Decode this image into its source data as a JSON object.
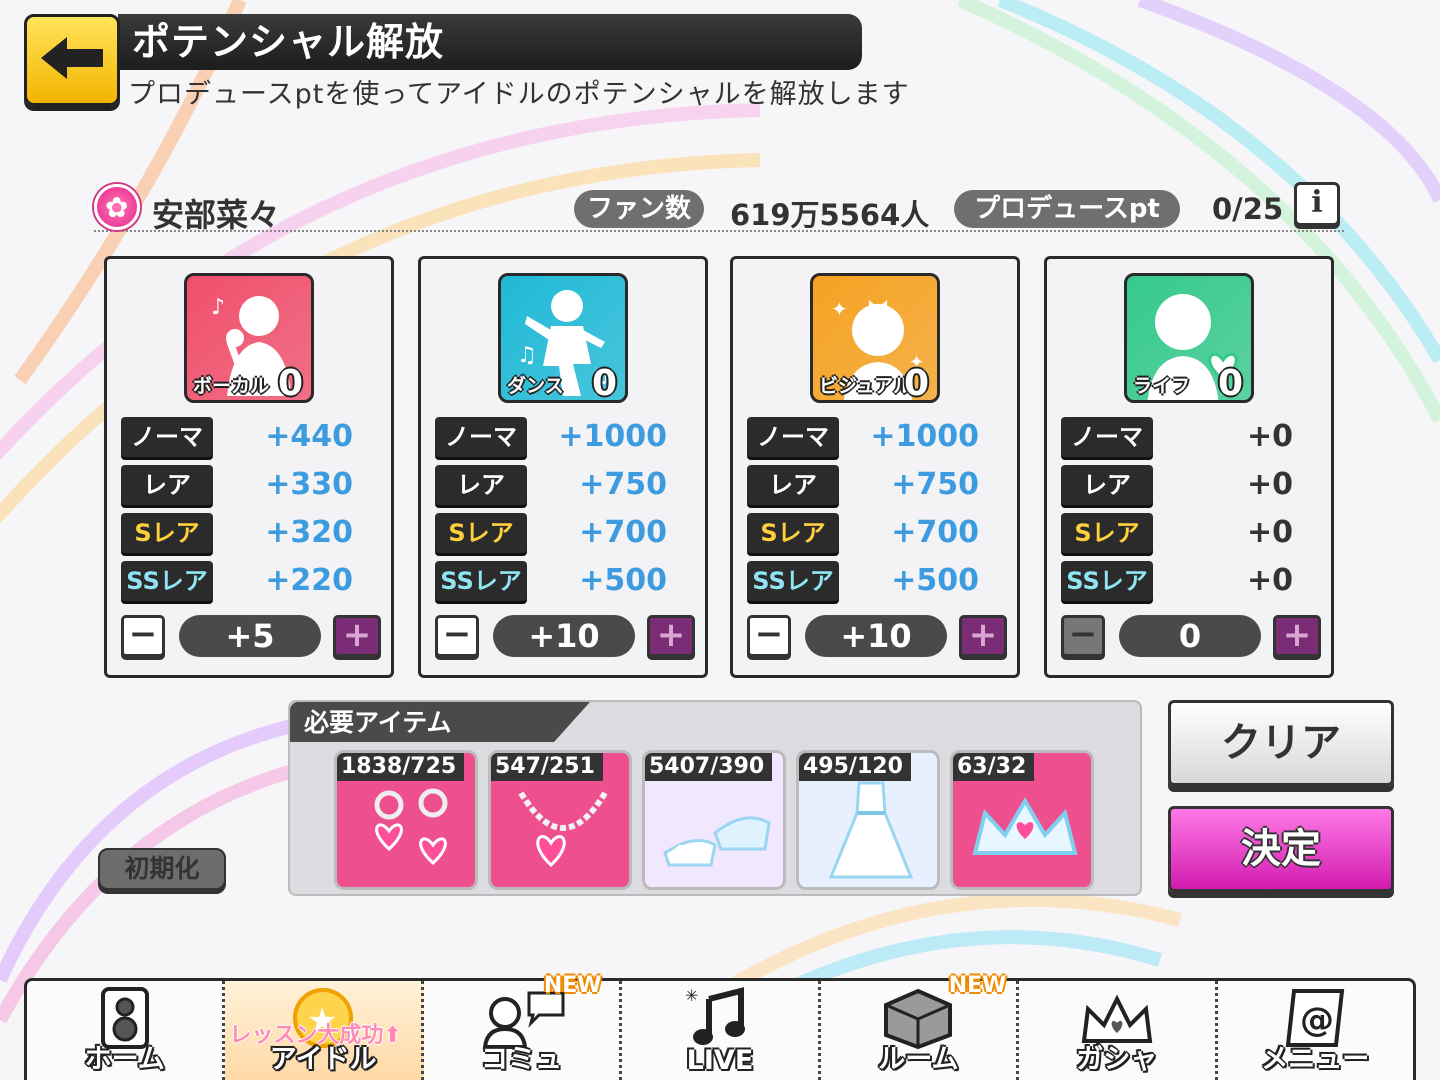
{
  "header": {
    "title": "ポテンシャル解放",
    "subtitle": "プロデュースptを使ってアイドルのポテンシャルを解放します"
  },
  "idol": {
    "name": "安部菜々",
    "fans_label": "ファン数",
    "fans_value": "619万5564人",
    "pt_label": "プロデュースpt",
    "pt_value": "0/25",
    "info_label": "i"
  },
  "panels": [
    {
      "stat": "ボーカル",
      "level": "0",
      "color": "#f04f6b",
      "rows": [
        {
          "rarity": "ノーマル",
          "value": "+440"
        },
        {
          "rarity": "レア",
          "value": "+330"
        },
        {
          "rarity": "Sレア",
          "value": "+320"
        },
        {
          "rarity": "SSレア",
          "value": "+220"
        }
      ],
      "step": "+5"
    },
    {
      "stat": "ダンス",
      "level": "0",
      "color": "#1fb9d6",
      "rows": [
        {
          "rarity": "ノーマル",
          "value": "+1000"
        },
        {
          "rarity": "レア",
          "value": "+750"
        },
        {
          "rarity": "Sレア",
          "value": "+700"
        },
        {
          "rarity": "SSレア",
          "value": "+500"
        }
      ],
      "step": "+10"
    },
    {
      "stat": "ビジュアル",
      "level": "0",
      "color": "#f5a221",
      "rows": [
        {
          "rarity": "ノーマル",
          "value": "+1000"
        },
        {
          "rarity": "レア",
          "value": "+750"
        },
        {
          "rarity": "Sレア",
          "value": "+700"
        },
        {
          "rarity": "SSレア",
          "value": "+500"
        }
      ],
      "step": "+10"
    },
    {
      "stat": "ライフ",
      "level": "0",
      "color": "#35c98c",
      "rows": [
        {
          "rarity": "ノーマル",
          "value": "+0"
        },
        {
          "rarity": "レア",
          "value": "+0"
        },
        {
          "rarity": "Sレア",
          "value": "+0"
        },
        {
          "rarity": "SSレア",
          "value": "+0"
        }
      ],
      "step": "0"
    }
  ],
  "stepper": {
    "minus": "−",
    "plus": "+"
  },
  "items": {
    "label": "必要アイテム",
    "list": [
      {
        "name": "earrings-icon",
        "count": "1838/725",
        "bg": "#ee4f8f"
      },
      {
        "name": "necklace-icon",
        "count": "547/251",
        "bg": "#ee4f8f"
      },
      {
        "name": "glass-shoes-icon",
        "count": "5407/390",
        "bg": "#f1e7ff"
      },
      {
        "name": "dress-icon",
        "count": "495/120",
        "bg": "#e8f0ff"
      },
      {
        "name": "tiara-icon",
        "count": "63/32",
        "bg": "#ee4f8f"
      }
    ]
  },
  "buttons": {
    "init": "初期化",
    "clear": "クリア",
    "decide": "決定"
  },
  "nav": {
    "items": [
      {
        "label": "ホーム",
        "icon": "speaker-icon"
      },
      {
        "label": "アイドル",
        "icon": "star-badge-icon",
        "banner": "レッスン大成功⬆"
      },
      {
        "label": "コミュ",
        "icon": "chat-icon",
        "badge": "NEW"
      },
      {
        "label": "LIVE",
        "icon": "music-note-icon"
      },
      {
        "label": "ルーム",
        "icon": "room-cube-icon",
        "badge": "NEW"
      },
      {
        "label": "ガシャ",
        "icon": "crown-icon"
      },
      {
        "label": "メニュー",
        "icon": "menu-icon"
      }
    ]
  }
}
